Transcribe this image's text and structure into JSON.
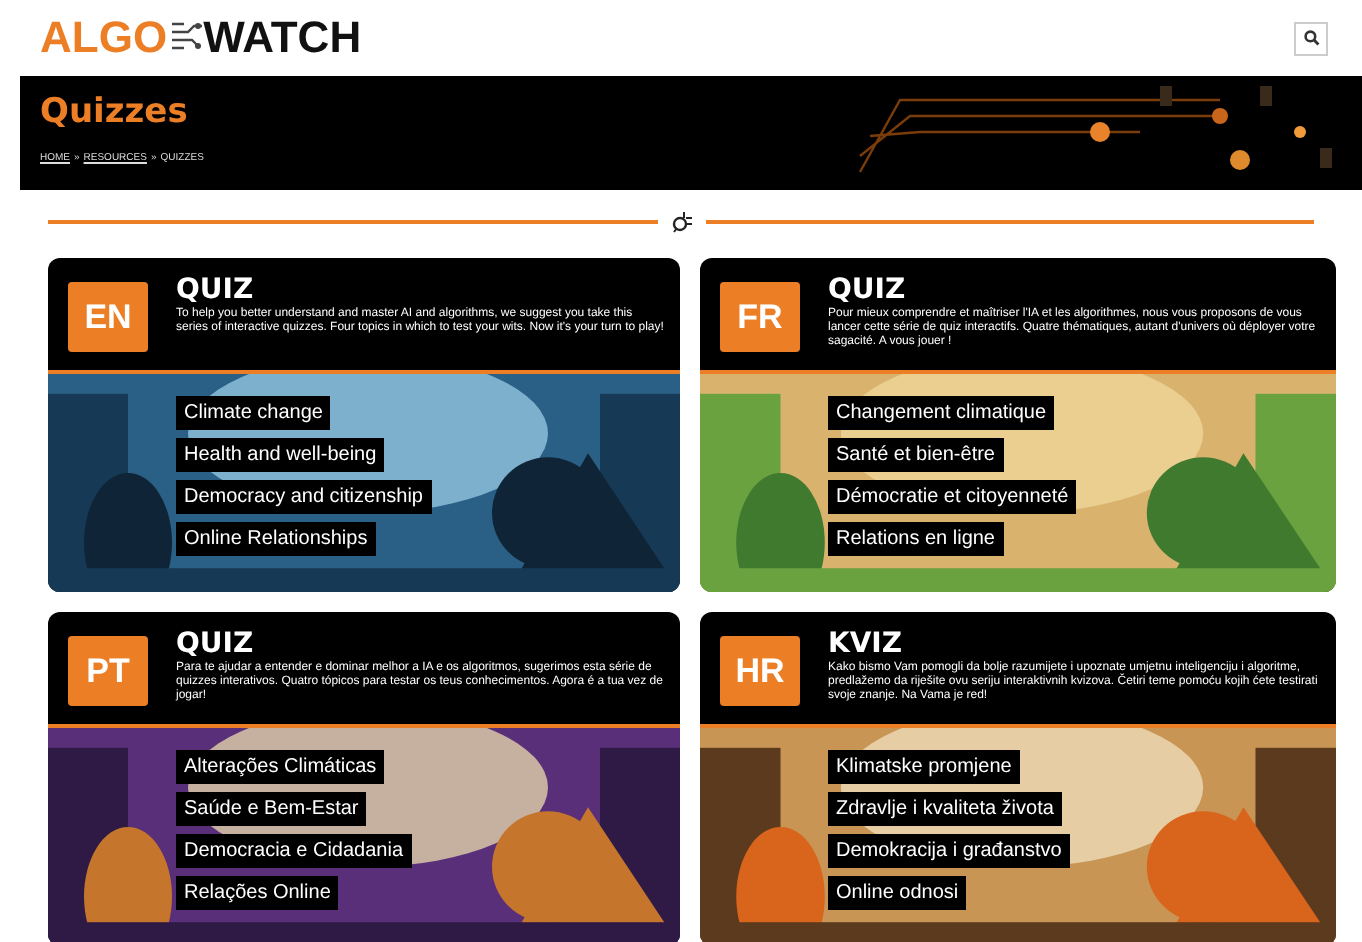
{
  "logo": {
    "part_1": "ALGO",
    "part_2": "WATCH"
  },
  "banner": {
    "title": "Quizzes",
    "breadcrumb": [
      {
        "label": "HOME",
        "link": true
      },
      {
        "label": "RESOURCES",
        "link": true
      },
      {
        "label": "QUIZZES",
        "link": false
      }
    ],
    "separator": "»"
  },
  "cards": [
    {
      "badge": "EN",
      "title": "QUIZ",
      "description": "To help you better understand and master AI and algorithms, we suggest you take this series of interactive quizzes. Four topics in which to test your wits. Now it's your turn to play!",
      "topics": [
        "Climate change",
        "Health and well-being",
        "Democracy and citizenship",
        "Online Relationships"
      ]
    },
    {
      "badge": "FR",
      "title": "QUIZ",
      "description": "Pour mieux comprendre et maîtriser l'IA et les algorithmes, nous vous proposons de vous lancer cette série de quiz interactifs. Quatre thématiques, autant d'univers où déployer votre sagacité. A vous jouer !",
      "topics": [
        "Changement climatique",
        "Santé et bien-être",
        "Démocratie et citoyenneté",
        "Relations en ligne"
      ]
    },
    {
      "badge": "PT",
      "title": "QUIZ",
      "description": "Para te ajudar a entender e dominar melhor a IA e os algoritmos, sugerimos esta série de quizzes interativos. Quatro tópicos para testar os teus conhecimentos. Agora é a tua vez de jogar!",
      "topics": [
        "Alterações Climáticas",
        "Saúde e Bem-Estar",
        "Democracia e Cidadania",
        "Relações Online"
      ]
    },
    {
      "badge": "HR",
      "title": "KVIZ",
      "description": "Kako bismo Vam pomogli da bolje razumijete i upoznate umjetnu inteligenciju i algoritme, predlažemo da riješite ovu seriju interaktivnih kvizova. Četiri teme pomoću kojih ćete testirati svoje znanje. Na Vama je red!",
      "topics": [
        "Klimatske promjene",
        "Zdravlje i kvaliteta života",
        "Demokracija i građanstvo",
        "Online odnosi"
      ]
    }
  ]
}
